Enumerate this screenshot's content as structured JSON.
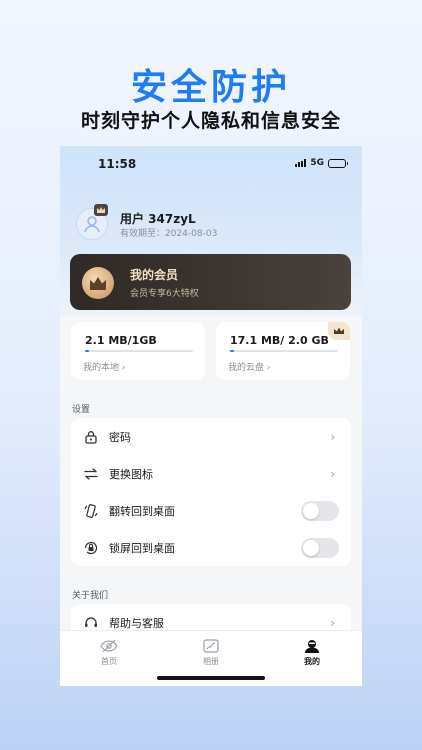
{
  "promo": {
    "headline": "安全防护",
    "subline": "时刻守护个人隐私和信息安全"
  },
  "status_bar": {
    "time": "11:58",
    "network": "5G"
  },
  "profile": {
    "username": "用户 347zyL",
    "expiry": "有效期至：2024-08-03",
    "avatar_icon": "user-icon",
    "badge_icon": "crown-icon"
  },
  "vip": {
    "title": "我的会员",
    "subtitle": "会员专享6大特权",
    "icon": "crown-icon"
  },
  "storage": {
    "local": {
      "value": "2.1 MB/1GB",
      "label": "我的本地 ›",
      "used_fraction": 0.002
    },
    "cloud": {
      "value": "17.1 MB/ 2.0 GB",
      "label": "我的云盘 ›",
      "used_fraction": 0.009
    }
  },
  "settings": {
    "section_title": "设置",
    "items": [
      {
        "label": "密码",
        "icon": "lock-icon",
        "control": "chevron"
      },
      {
        "label": "更换图标",
        "icon": "swap-icon",
        "control": "chevron"
      },
      {
        "label": "翻转回到桌面",
        "icon": "flip-phone-icon",
        "control": "toggle",
        "on": false
      },
      {
        "label": "锁屏回到桌面",
        "icon": "lock-screen-icon",
        "control": "toggle",
        "on": false
      }
    ]
  },
  "about": {
    "section_title": "关于我们",
    "items": [
      {
        "label": "帮助与客服",
        "icon": "headset-icon",
        "control": "chevron"
      }
    ]
  },
  "tabbar": {
    "tabs": [
      {
        "label": "首页",
        "icon": "eye-off-icon",
        "active": false
      },
      {
        "label": "相册",
        "icon": "album-icon",
        "active": false
      },
      {
        "label": "我的",
        "icon": "person-icon",
        "active": true
      }
    ]
  },
  "colors": {
    "accent": "#1f7cf2",
    "vip_card": "#3d3632",
    "vip_text": "#f1dfc4"
  }
}
